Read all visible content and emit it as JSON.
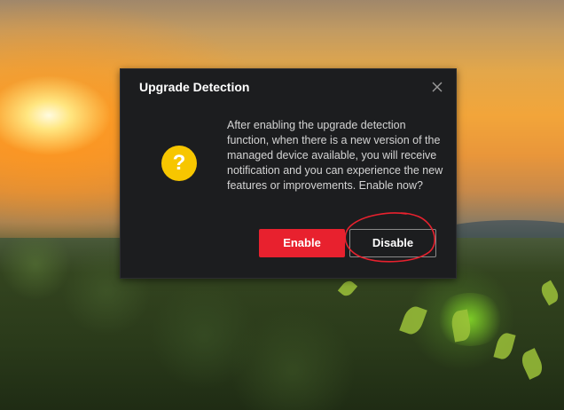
{
  "dialog": {
    "title": "Upgrade Detection",
    "message": "After enabling the upgrade detection function, when there is a new version of the managed device available, you will receive notification and you can experience the new features or improvements. Enable now?",
    "icon": "question-icon",
    "icon_glyph": "?",
    "enable_label": "Enable",
    "disable_label": "Disable",
    "close_icon": "close-icon"
  },
  "colors": {
    "dialog_bg": "#1c1d1f",
    "primary_button": "#e8212e",
    "icon": "#f7c600",
    "annotation": "#e8212e"
  }
}
